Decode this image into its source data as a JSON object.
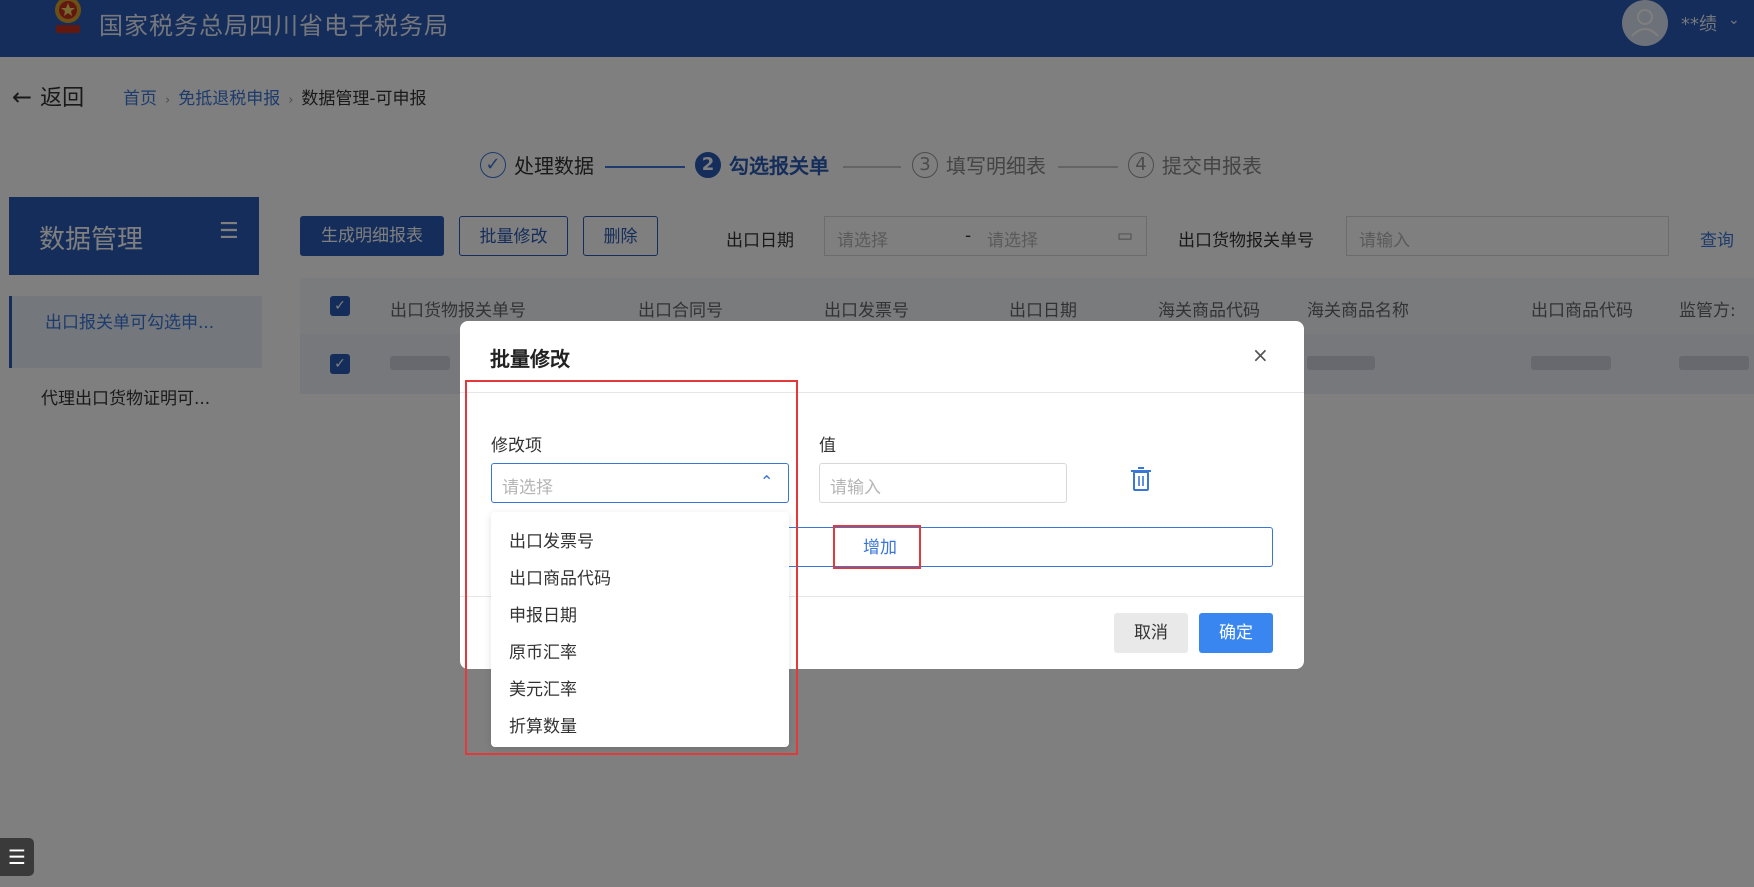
{
  "header": {
    "title": "国家税务总局四川省电子税务局",
    "username": "**绩",
    "logo_icon": "tax-emblem-icon",
    "avatar_icon": "user-avatar-icon"
  },
  "nav": {
    "back_label": "返回",
    "breadcrumb": [
      "首页",
      "免抵退税申报",
      "数据管理-可申报"
    ]
  },
  "steps": [
    {
      "num": "✓",
      "label": "处理数据",
      "state": "done"
    },
    {
      "num": "2",
      "label": "勾选报关单",
      "state": "active"
    },
    {
      "num": "3",
      "label": "填写明细表",
      "state": "todo"
    },
    {
      "num": "4",
      "label": "提交申报表",
      "state": "todo"
    }
  ],
  "sidebar": {
    "title": "数据管理",
    "items": [
      {
        "label": "出口报关单可勾选申...",
        "active": true
      },
      {
        "label": "代理出口货物证明可...",
        "active": false
      }
    ]
  },
  "toolbar": {
    "generate_label": "生成明细报表",
    "batch_edit_label": "批量修改",
    "delete_label": "删除",
    "export_date_label": "出口日期",
    "date_start_placeholder": "请选择",
    "date_end_placeholder": "请选择",
    "date_sep": "-",
    "declaration_no_label": "出口货物报关单号",
    "declaration_no_placeholder": "请输入",
    "query_label": "查询"
  },
  "table": {
    "columns": [
      "出口货物报关单号",
      "出口合同号",
      "出口发票号",
      "出口日期",
      "海关商品代码",
      "海关商品名称",
      "出口商品代码",
      "监管方式"
    ],
    "visible_columns_text": [
      "出口货物报关单号",
      "出口合同号",
      "出口发票号",
      "出口日期",
      "海关商品代码",
      "海关商品名称",
      "出口商品代码",
      "监管方:"
    ]
  },
  "modal": {
    "title": "批量修改",
    "close_symbol": "×",
    "field_label": "修改项",
    "field_placeholder": "请选择",
    "value_label": "值",
    "value_placeholder": "请输入",
    "add_label": "增加",
    "cancel_label": "取消",
    "confirm_label": "确定",
    "dropdown_options": [
      "出口发票号",
      "出口商品代码",
      "申报日期",
      "原币汇率",
      "美元汇率",
      "折算数量"
    ]
  },
  "colors": {
    "brand": "#2b5bb5",
    "link": "#3a76d8",
    "confirm": "#3a86f0",
    "highlight": "#e23a3a"
  }
}
